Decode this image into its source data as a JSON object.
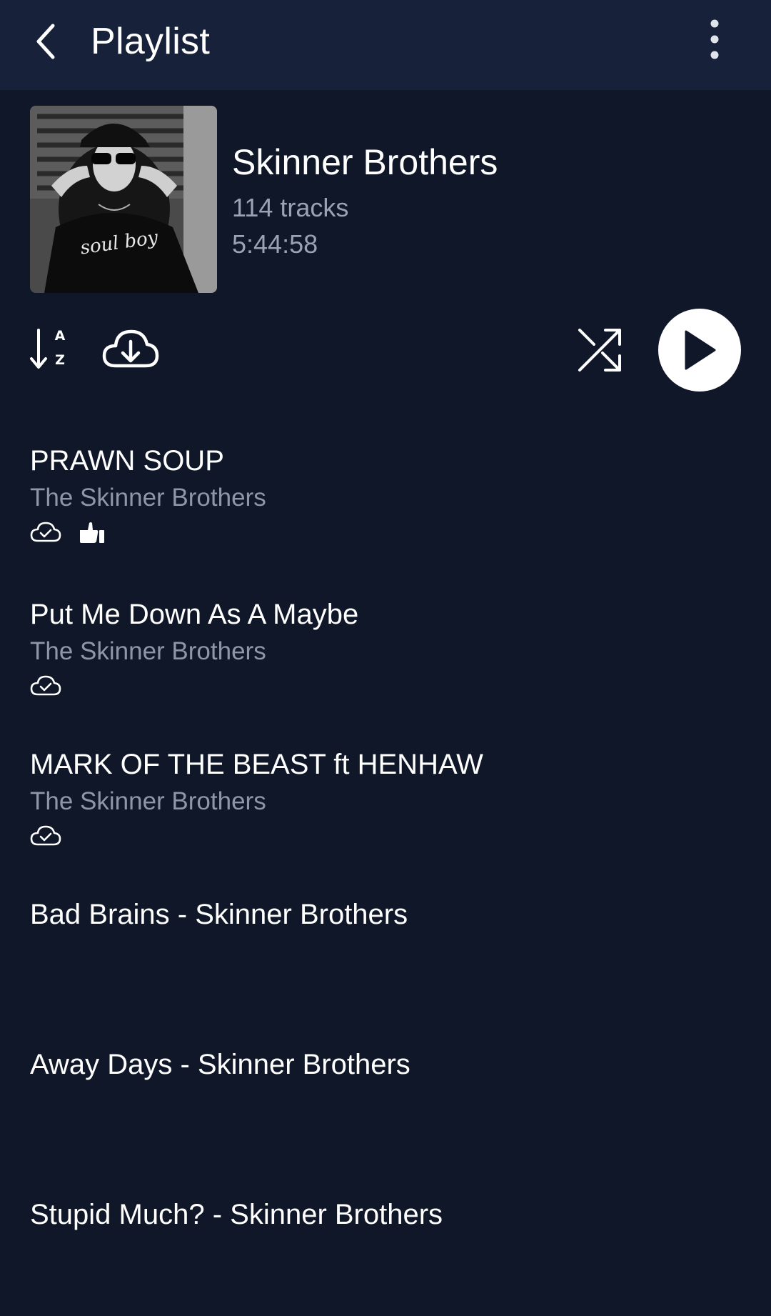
{
  "app_bar": {
    "title": "Playlist",
    "back_icon": "chevron-left-icon",
    "more_icon": "more-vertical-icon"
  },
  "playlist": {
    "name": "Skinner Brothers",
    "track_count": "114 tracks",
    "duration": "5:44:58",
    "cover_text": "soul boy"
  },
  "actions": {
    "sort_icon": "sort-az-icon",
    "sort_letter_a": "A",
    "sort_letter_z": "Z",
    "download_icon": "cloud-download-icon",
    "shuffle_icon": "shuffle-icon",
    "play_icon": "play-icon"
  },
  "tracks": [
    {
      "title": "PRAWN SOUP",
      "artist": "The Skinner Brothers",
      "downloaded": true,
      "liked": true
    },
    {
      "title": "Put Me Down As A Maybe",
      "artist": "The Skinner Brothers",
      "downloaded": true,
      "liked": false
    },
    {
      "title": "MARK OF THE BEAST ft HENHAW",
      "artist": "The Skinner Brothers",
      "downloaded": true,
      "liked": false
    },
    {
      "title": "Bad Brains - Skinner Brothers",
      "artist": "",
      "downloaded": false,
      "liked": false
    },
    {
      "title": "Away Days - Skinner Brothers",
      "artist": "",
      "downloaded": false,
      "liked": false
    },
    {
      "title": "Stupid Much? - Skinner Brothers",
      "artist": "",
      "downloaded": false,
      "liked": false
    }
  ],
  "colors": {
    "background": "#0f1729",
    "app_bar": "#17213a",
    "primary_text": "#ffffff",
    "secondary_text": "#8e96a8"
  }
}
